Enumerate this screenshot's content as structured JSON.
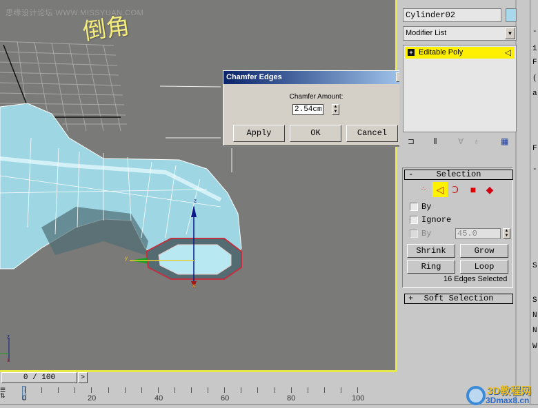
{
  "viewport": {
    "watermark": "思缘设计论坛 WWW.MISSYUAN.COM",
    "annotation": "倒角",
    "gizmo_axes": {
      "x": "x",
      "y": "y",
      "z": "z"
    }
  },
  "dialog": {
    "title": "Chamfer Edges",
    "close_icon": "×",
    "amount_label": "Chamfer Amount:",
    "amount_value": "2.54cm",
    "apply_label": "Apply",
    "ok_label": "OK",
    "cancel_label": "Cancel"
  },
  "command_panel": {
    "object_name": "Cylinder02",
    "object_color": "#a8d8ec",
    "modifier_list": "Modifier List",
    "stack": [
      {
        "label": "Editable Poly",
        "expand": "+",
        "active_subobject": "edge"
      }
    ],
    "selection_rollout": {
      "title": "Selection",
      "collapse": "-",
      "subobject_levels": [
        "vertex",
        "edge",
        "border",
        "polygon",
        "element"
      ],
      "active_level": "edge",
      "by_vertex_label": "By",
      "ignore_label": "Ignore",
      "by_angle_label": "By",
      "angle_value": "45.0",
      "shrink_label": "Shrink",
      "grow_label": "Grow",
      "ring_label": "Ring",
      "loop_label": "Loop",
      "status": "16 Edges Selected"
    },
    "soft_selection_rollout": {
      "title": "Soft Selection",
      "expand": "+"
    }
  },
  "timeline": {
    "frame_display": "0 / 100",
    "next_label": ">",
    "ticks": [
      "0",
      "20",
      "40",
      "60",
      "80",
      "100"
    ]
  },
  "right_column_letters": [
    "-",
    "1",
    "F",
    "(",
    "a",
    "F",
    "-",
    "S",
    "S",
    "N",
    "N",
    "W"
  ],
  "logo": {
    "text_top": "3D教程网",
    "text_bottom": "3Dmax8.cn"
  }
}
